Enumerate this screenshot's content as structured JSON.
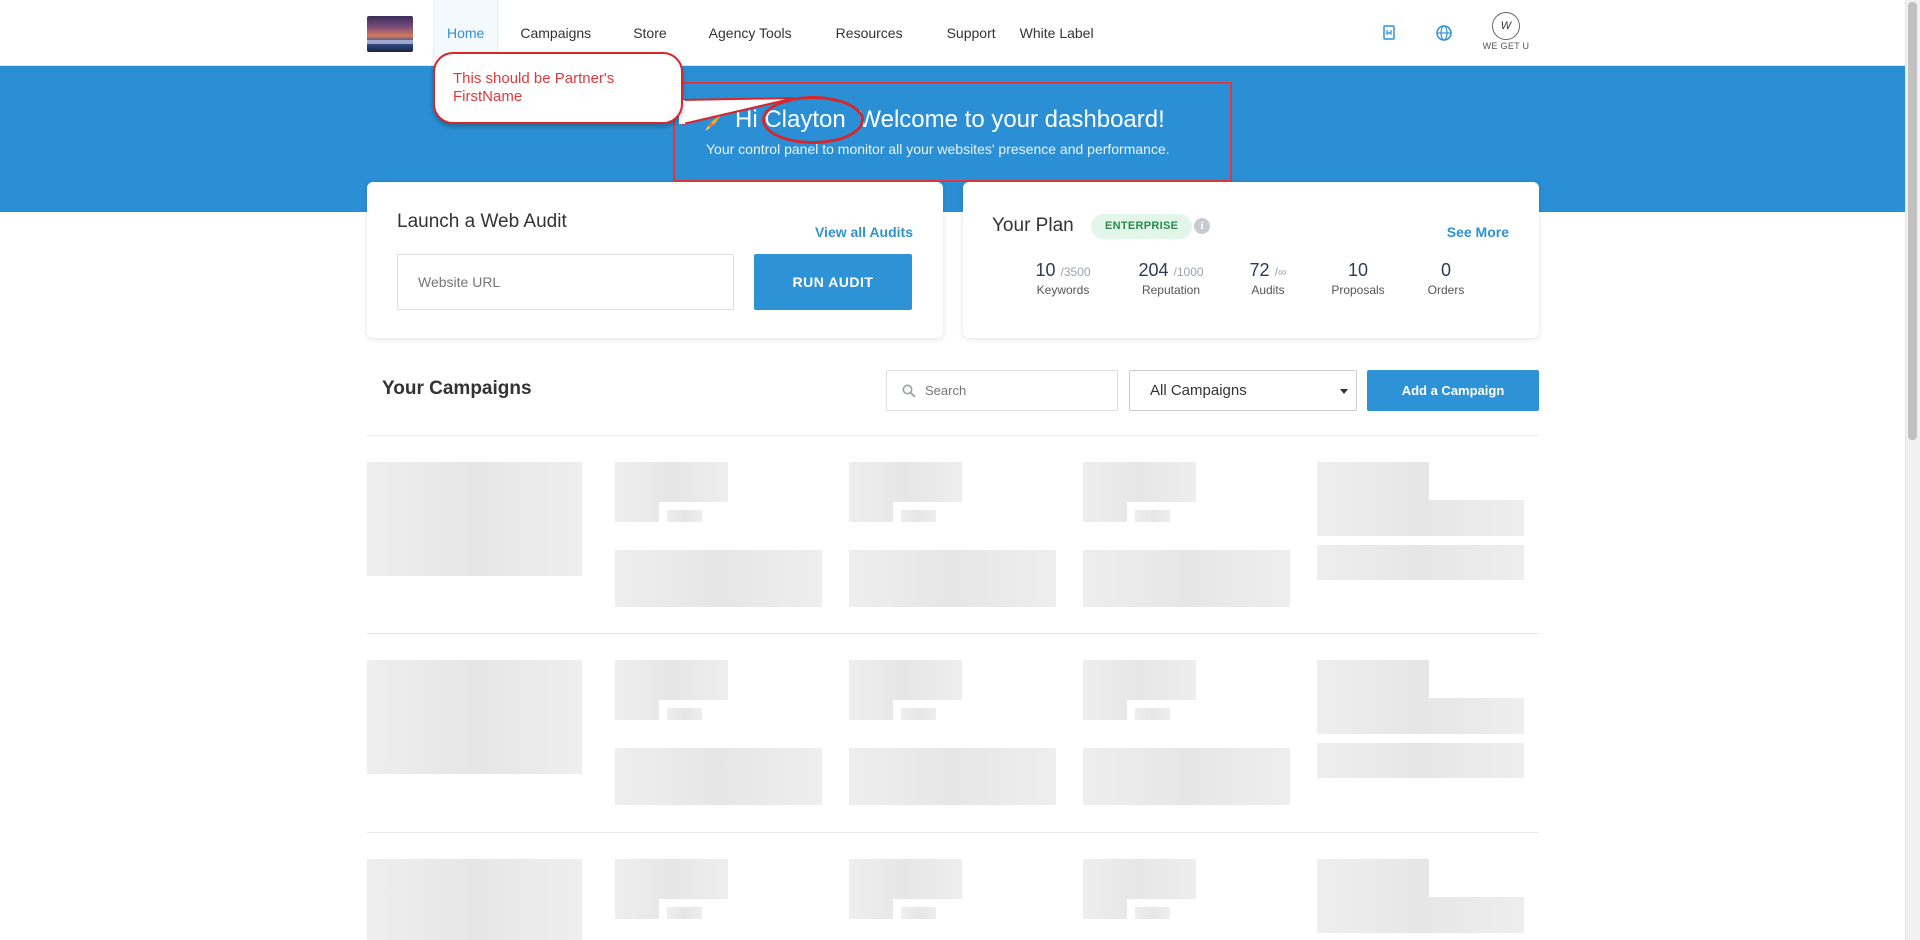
{
  "nav": {
    "items": [
      {
        "label": "Home",
        "active": true
      },
      {
        "label": "Campaigns"
      },
      {
        "label": "Store"
      },
      {
        "label": "Agency Tools"
      },
      {
        "label": "Resources"
      },
      {
        "label": "Support"
      },
      {
        "label": "White Label"
      }
    ],
    "right_icons": [
      "bookmark-icon",
      "globe-icon"
    ],
    "avatar_text": "WE GET U",
    "avatar_mark": "W"
  },
  "hero": {
    "greeting_prefix": "Hi",
    "first_name": "Clayton",
    "greeting_suffix": "Welcome to your dashboard!",
    "subtitle": "Your control panel to monitor all your websites' presence and performance.",
    "annotation": "This should be Partner's FirstName"
  },
  "audit": {
    "title": "Launch a Web Audit",
    "view_all": "View all Audits",
    "url_placeholder": "Website URL",
    "run_label": "RUN AUDIT"
  },
  "plan": {
    "title": "Your Plan",
    "badge": "ENTERPRISE",
    "info": "i",
    "see_more": "See More",
    "stats": [
      {
        "value": "10",
        "max": "/3500",
        "label": "Keywords"
      },
      {
        "value": "204",
        "max": "/1000",
        "label": "Reputation"
      },
      {
        "value": "72",
        "max": "/∞",
        "label": "Audits"
      },
      {
        "value": "10",
        "max": "",
        "label": "Proposals"
      },
      {
        "value": "0",
        "max": "",
        "label": "Orders"
      }
    ]
  },
  "campaigns": {
    "title": "Your Campaigns",
    "search_placeholder": "Search",
    "filter_value": "All Campaigns",
    "add_label": "Add a Campaign"
  },
  "colors": {
    "accent": "#2e92d6",
    "hero_bg": "#2a8fd4",
    "annotation_red": "#e0383c",
    "badge_bg": "#e2f6ea",
    "badge_text": "#2a8a4c"
  }
}
